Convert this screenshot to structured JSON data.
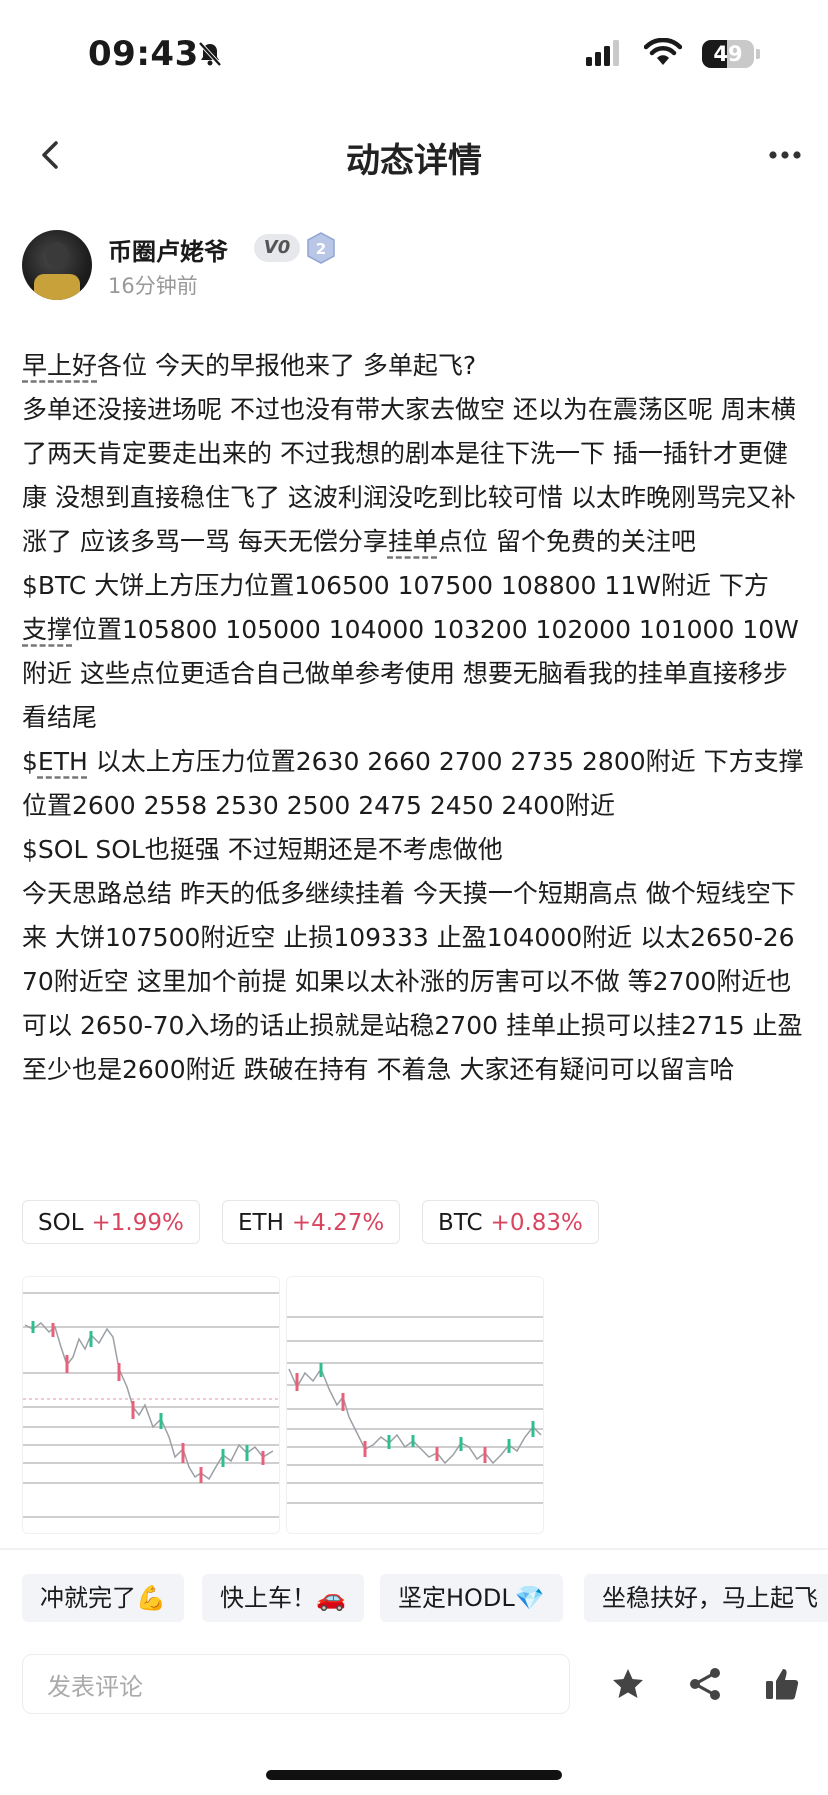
{
  "status_bar": {
    "time": "09:43",
    "battery": "49",
    "battery_level": 0.49
  },
  "nav": {
    "title": "动态详情"
  },
  "author": {
    "name": "币圈卢姥爷",
    "vip_badge": "V0",
    "level_badge": "2",
    "time_ago": "16分钟前"
  },
  "post": {
    "p1a": "早上好",
    "p1b": "各位 今天的早报他来了 多单起飞?\n多单还没接进场呢 不过也没有带大家去做空 还以为在震荡区呢 周末横了两天肯定要走出来的 不过我想的剧本是往下洗一下 插一插针才更健康 没想到直接稳住飞了 这波利润没吃到比较可惜 以太昨晚刚骂完又补涨了 应该多骂一骂 每天无偿分享",
    "p1c": "挂单",
    "p1d": "点位 留个免费的关注吧\n$BTC 大饼上方压力位置106500 107500 108800 11W附近 下方",
    "p2a": "支撑",
    "p2b": "位置105800 105000 104000 103200 102000 101000 10W附近 这些点位更适合自己做单参考使用 想要无脑看我的挂单直接移步看结尾\n$",
    "p3a": "ETH",
    "p3b": " 以太上方压力位置2630 2660 2700 2735 2800附近 下方支撑位置2600 2558 2530 2500 2475 2450 2400附近\n$SOL SOL也挺强 不过短期还是不考虑做他\n今天思路总结 昨天的低多继续挂着 今天摸一个短期高点 做个短线空下来 大饼107500附近空 止损109333 止盈104000附近 以太2650-2670附近空 这里加个前提 如果以太补涨的厉害可以不做 等2700附近也可以 2650-70入场的话止损就是站稳2700 挂单止损可以挂2715 止盈至少也是2600附近 跌破在持有 不着急 大家还有疑问可以留言哈"
  },
  "tickers": [
    {
      "symbol": "SOL",
      "change": "+1.99%"
    },
    {
      "symbol": "ETH",
      "change": "+4.27%"
    },
    {
      "symbol": "BTC",
      "change": "+0.83%"
    }
  ],
  "quick_replies": [
    "冲就完了💪",
    "快上车！🚗",
    "坚定HODL💎",
    "坐稳扶好，马上起飞"
  ],
  "comment": {
    "placeholder": "发表评论"
  },
  "colors": {
    "up": "#d9455f",
    "candle_up": "#2fbf8f",
    "candle_down": "#e8607a"
  }
}
